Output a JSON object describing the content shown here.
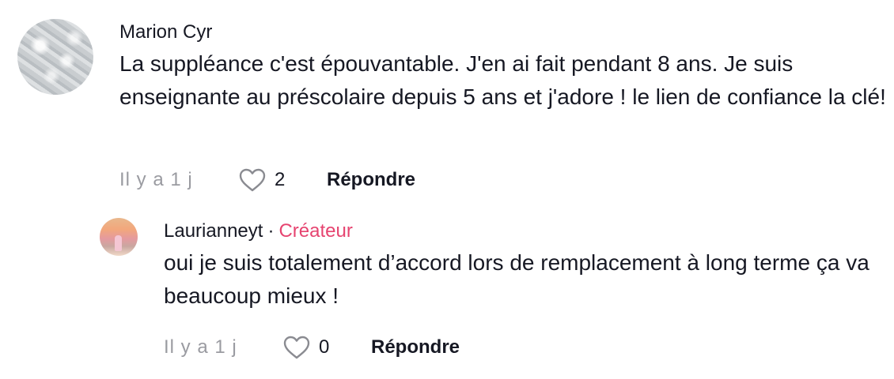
{
  "comments": [
    {
      "author": "Marion Cyr",
      "text": "La suppléance c'est épouvantable. J'en ai fait pendant 8 ans. Je suis enseignante au préscolaire depuis 5 ans et j'adore ! le lien de confiance la clé!",
      "time": "Il y a 1 j",
      "likes": "2",
      "reply_label": "Répondre",
      "avatar_icon": "avatar"
    }
  ],
  "replies": [
    {
      "author": "Laurianneyt",
      "separator": "·",
      "badge": "Créateur",
      "text": "oui je suis totalement d’accord lors de remplacement à long terme ça va beaucoup mieux !",
      "time": "Il y a 1 j",
      "likes": "0",
      "reply_label": "Répondre",
      "avatar_icon": "avatar"
    }
  ],
  "colors": {
    "text": "#161823",
    "muted": "#9a9ba1",
    "creator_badge": "#e64470",
    "heart_outline": "#8a8b91"
  },
  "icons": {
    "like": "heart-outline-icon"
  }
}
